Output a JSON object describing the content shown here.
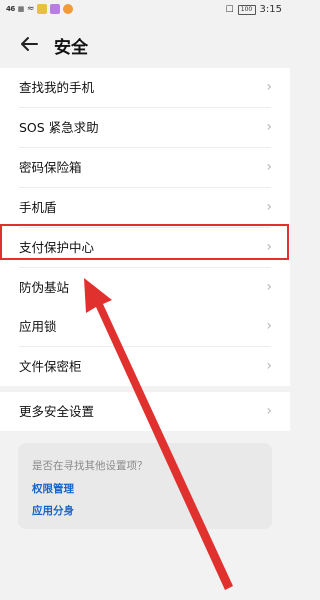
{
  "status_bar": {
    "signal_left": "46",
    "time": "3:15",
    "battery": "100"
  },
  "header": {
    "title": "安全"
  },
  "groups": [
    {
      "items": [
        {
          "label": "查找我的手机"
        },
        {
          "label": "SOS 紧急求助"
        },
        {
          "label": "密码保险箱"
        },
        {
          "label": "手机盾"
        },
        {
          "label": "支付保护中心"
        },
        {
          "label": "防伪基站"
        }
      ]
    },
    {
      "items": [
        {
          "label": "应用锁"
        },
        {
          "label": "文件保密柜"
        }
      ]
    },
    {
      "items": [
        {
          "label": "更多安全设置"
        }
      ]
    }
  ],
  "suggestion": {
    "title": "是否在寻找其他设置项？",
    "links": [
      "权限管理",
      "应用分身"
    ]
  },
  "colors": {
    "annotation_red": "#e0312f",
    "link_blue": "#1a64c7"
  }
}
